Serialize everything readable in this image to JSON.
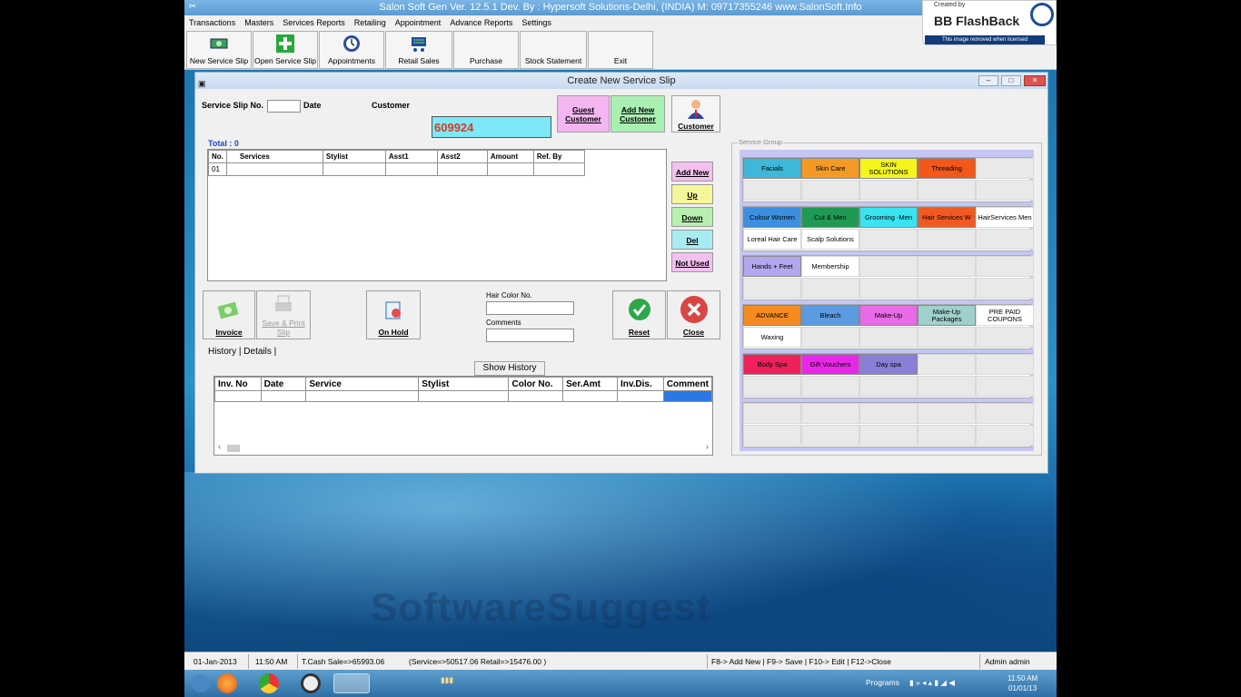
{
  "app": {
    "title": "Salon Soft Gen Ver. 12.5.1 Dev. By : Hypersoft Solutions-Delhi, (INDIA) M: 09717355246  www.SalonSoft.Info"
  },
  "menu": [
    "Transactions",
    "Masters",
    "Services Reports",
    "Retailing",
    "Appointment",
    "Advance Reports",
    "Settings"
  ],
  "toolbar": [
    "New Service Slip",
    "Open Service Slip",
    "Appointments",
    "Retail Sales",
    "Purchase",
    "Stock Statement",
    "Exit"
  ],
  "flashback": {
    "created": "Created by",
    "brand": "BB FlashBack",
    "license": "This image removed when licensed"
  },
  "form": {
    "title": "Create New Service Slip",
    "slip_label": "Service Slip No.",
    "date_label": "Date",
    "customer_label": "Customer",
    "customer_value": "609924",
    "guest_btn": "Guest Customer",
    "add_customer_btn": "Add New Customer",
    "customer_btn": "Customer",
    "total": "Total : 0",
    "grid_headers": [
      "No.",
      "Services",
      "Stylist",
      "Asst1",
      "Asst2",
      "Amount",
      "Ref. By"
    ],
    "grid_row_no": "01",
    "side_buttons": [
      "Add New",
      "Up",
      "Down",
      "Del",
      "Not Used"
    ],
    "invoice_btn": "Invoice",
    "save_print_btn": "Save & Print Slip",
    "onhold_btn": "On Hold",
    "hair_color_label": "Hair Color No.",
    "comments_label": "Comments",
    "reset_btn": "Reset",
    "close_btn": "Close",
    "tab_history": "History",
    "tab_details": "Details",
    "show_history_btn": "Show History",
    "history_headers": [
      "Inv. No",
      "Date",
      "Service",
      "Stylist",
      "Color No.",
      "Ser.Amt",
      "Inv.Dis.",
      "Comment"
    ],
    "group_caption": "Service Group"
  },
  "service_groups": [
    [
      "Facials",
      "Skin Care",
      "SKIN SOLUTIONS",
      "Threading",
      ""
    ],
    [
      "Colour Women",
      "Cut & Men",
      "Grooming -Men",
      "Hair Services W",
      "HairServices Men"
    ],
    [
      "Loreal Hair Care",
      "Scalp Solutions",
      "",
      "",
      ""
    ],
    [
      "Hands + Feet",
      "Membership",
      "",
      "",
      ""
    ],
    [
      "ADVANCE",
      "Bleach",
      "Make-Up",
      "Make-Up Packages",
      "PRE PAID COUPONS"
    ],
    [
      "Waxing",
      "",
      "",
      "",
      ""
    ],
    [
      "Body Spa",
      "Gift Vouchers",
      "Day spa",
      "",
      ""
    ]
  ],
  "group_colors": {
    "Facials": "#3fb7d9",
    "Skin Care": "#f49a24",
    "SKIN SOLUTIONS": "#f5f51c",
    "Threading": "#f2581a",
    "Colour Women": "#3c8fe0",
    "Cut & Men": "#1f9a55",
    "Grooming -Men": "#39e4f0",
    "Hair Services W": "#f05a22",
    "Hands + Feet": "#b3a6ee",
    "ADVANCE": "#f58a1f",
    "Bleach": "#5b9be0",
    "Make-Up": "#e86ae6",
    "Make-Up Packages": "#9fd0cc",
    "Body Spa": "#f0205a",
    "Gift Vouchers": "#e828e8",
    "Day spa": "#8a7fd6"
  },
  "status": {
    "date": "01-Jan-2013",
    "time": "11:50 AM",
    "cash": "T.Cash Sale=>65993.06",
    "breakdown": "(Service=>50517.06  Retail=>15476.00  )",
    "keys": "F8-> Add New | F9-> Save | F10-> Edit | F12->Close",
    "user": "Admin admin"
  },
  "taskbar": {
    "programs": "Programs",
    "clock_time": "11:50 AM",
    "clock_date": "01/01/13"
  },
  "watermark": "SoftwareSuggest"
}
